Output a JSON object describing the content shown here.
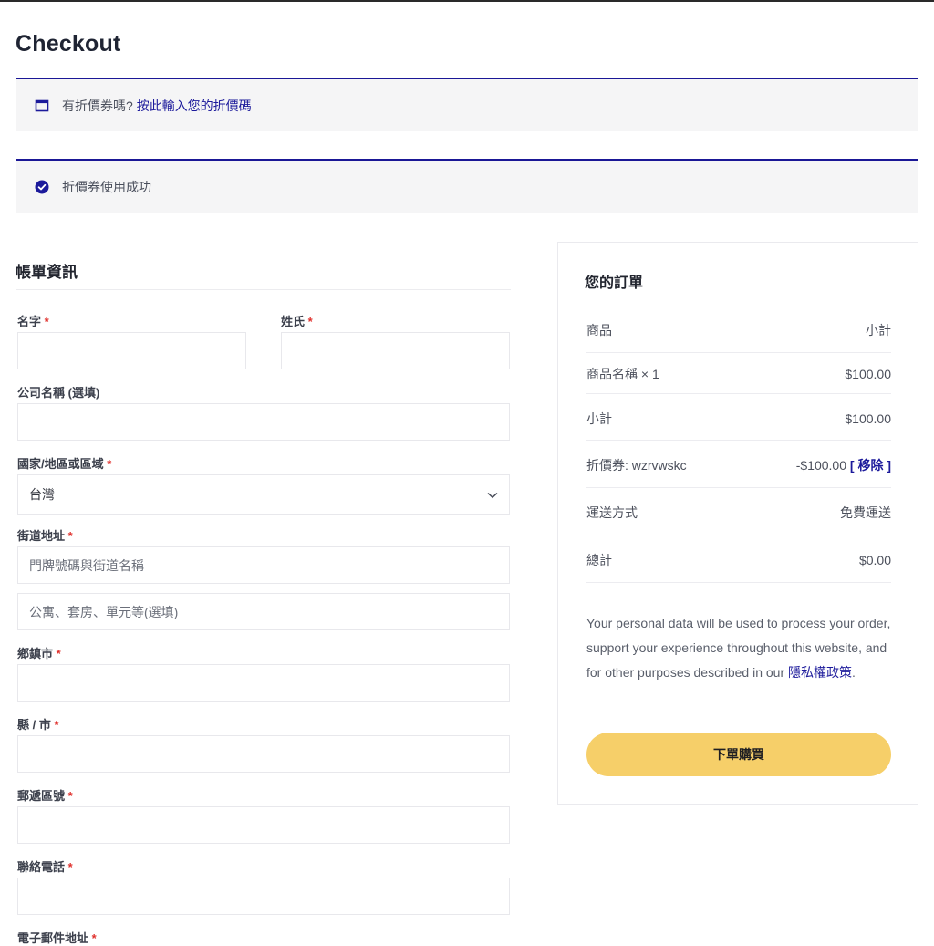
{
  "page": {
    "title": "Checkout"
  },
  "notices": {
    "coupon": {
      "prompt": "有折價券嗎?",
      "link": "按此輸入您的折價碼"
    },
    "success": {
      "message": "折價券使用成功"
    }
  },
  "billing": {
    "title": "帳單資訊",
    "required_mark": "*",
    "fields": {
      "first_name": {
        "label": "名字"
      },
      "last_name": {
        "label": "姓氏"
      },
      "company": {
        "label": "公司名稱 (選填)"
      },
      "country": {
        "label": "國家/地區或區域",
        "value": "台灣"
      },
      "street": {
        "label": "街道地址",
        "placeholder": "門牌號碼與街道名稱",
        "placeholder2": "公寓、套房、單元等(選填)"
      },
      "town": {
        "label": "鄉鎮市"
      },
      "county": {
        "label": "縣 / 市"
      },
      "postcode": {
        "label": "郵遞區號"
      },
      "phone": {
        "label": "聯絡電話"
      },
      "email": {
        "label": "電子郵件地址"
      }
    }
  },
  "order": {
    "title": "您的訂單",
    "header": {
      "product": "商品",
      "subtotal": "小計"
    },
    "item": {
      "name": "商品名稱 × 1",
      "price": "$100.00"
    },
    "subtotal": {
      "label": "小計",
      "value": "$100.00"
    },
    "coupon": {
      "label": "折價券: wzrvwskc",
      "value": "-$100.00",
      "remove": "[ 移除 ]"
    },
    "shipping": {
      "label": "運送方式",
      "value": "免費運送"
    },
    "total": {
      "label": "總計",
      "value": "$0.00"
    },
    "privacy": {
      "text": "Your personal data will be used to process your order, support your experience throughout this website, and for other purposes described in our ",
      "link": "隱私權政策",
      "end": "."
    },
    "place_order": "下單購買"
  },
  "colors": {
    "accent": "#1c1a9b",
    "button": "#f6cf69",
    "required": "#e0302c"
  }
}
